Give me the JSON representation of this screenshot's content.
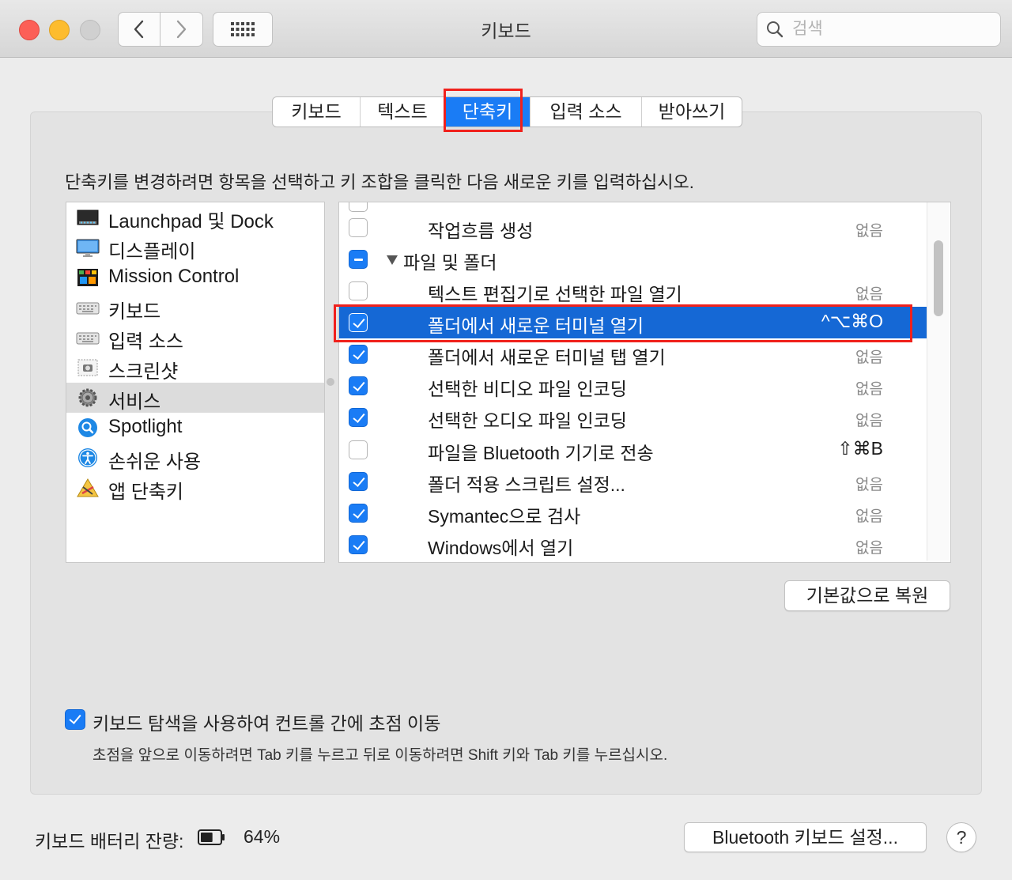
{
  "window": {
    "title": "키보드"
  },
  "search": {
    "placeholder": "검색",
    "value": ""
  },
  "tabs": [
    {
      "label": "키보드",
      "active": false
    },
    {
      "label": "텍스트",
      "active": false
    },
    {
      "label": "단축키",
      "active": true
    },
    {
      "label": "입력 소스",
      "active": false
    },
    {
      "label": "받아쓰기",
      "active": false
    }
  ],
  "instruction": "단축키를 변경하려면 항목을 선택하고 키 조합을 클릭한 다음 새로운 키를 입력하십시오.",
  "categories": [
    {
      "label": "Launchpad 및 Dock",
      "icon": "launchpad-dock-icon",
      "selected": false
    },
    {
      "label": "디스플레이",
      "icon": "display-icon",
      "selected": false
    },
    {
      "label": "Mission Control",
      "icon": "mission-control-icon",
      "selected": false
    },
    {
      "label": "키보드",
      "icon": "keyboard-icon",
      "selected": false
    },
    {
      "label": "입력 소스",
      "icon": "input-sources-icon",
      "selected": false
    },
    {
      "label": "스크린샷",
      "icon": "screenshot-icon",
      "selected": false
    },
    {
      "label": "서비스",
      "icon": "services-gear-icon",
      "selected": true
    },
    {
      "label": "Spotlight",
      "icon": "spotlight-icon",
      "selected": false
    },
    {
      "label": "손쉬운 사용",
      "icon": "accessibility-icon",
      "selected": false
    },
    {
      "label": "앱 단축키",
      "icon": "app-shortcuts-icon",
      "selected": false
    }
  ],
  "shortcuts": [
    {
      "name": "작업흐름 생성",
      "shortcut": "없음",
      "state": "off",
      "type": "item"
    },
    {
      "name": "파일 및 폴더",
      "shortcut": "",
      "state": "mixed",
      "type": "group"
    },
    {
      "name": "텍스트 편집기로 선택한 파일 열기",
      "shortcut": "없음",
      "state": "off",
      "type": "item"
    },
    {
      "name": "폴더에서 새로운 터미널 열기",
      "shortcut": "^⌥⌘O",
      "state": "on",
      "type": "item",
      "selected": true
    },
    {
      "name": "폴더에서 새로운 터미널 탭 열기",
      "shortcut": "없음",
      "state": "on",
      "type": "item"
    },
    {
      "name": "선택한 비디오 파일 인코딩",
      "shortcut": "없음",
      "state": "on",
      "type": "item"
    },
    {
      "name": "선택한 오디오 파일 인코딩",
      "shortcut": "없음",
      "state": "on",
      "type": "item"
    },
    {
      "name": "파일을 Bluetooth 기기로 전송",
      "shortcut": "⇧⌘B",
      "state": "off",
      "type": "item"
    },
    {
      "name": "폴더 적용 스크립트 설정...",
      "shortcut": "없음",
      "state": "on",
      "type": "item"
    },
    {
      "name": "Symantec으로 검사",
      "shortcut": "없음",
      "state": "on",
      "type": "item"
    },
    {
      "name": "Windows에서 열기",
      "shortcut": "없음",
      "state": "on",
      "type": "item"
    }
  ],
  "restore_button": "기본값으로 복원",
  "keyboard_navigation": {
    "checked": true,
    "label": "키보드 탐색을 사용하여 컨트롤 간에 초점 이동",
    "help": "초점을 앞으로 이동하려면 Tab 키를 누르고 뒤로 이동하려면 Shift 키와 Tab 키를 누르십시오."
  },
  "battery": {
    "label": "키보드 배터리 잔량:",
    "level": 0.64,
    "percent_text": "64%"
  },
  "bluetooth_button": "Bluetooth 키보드 설정...",
  "help_button": "?",
  "colors": {
    "accent": "#1a7cf5",
    "selection": "#1568d5",
    "annotation": "#f0211c"
  }
}
